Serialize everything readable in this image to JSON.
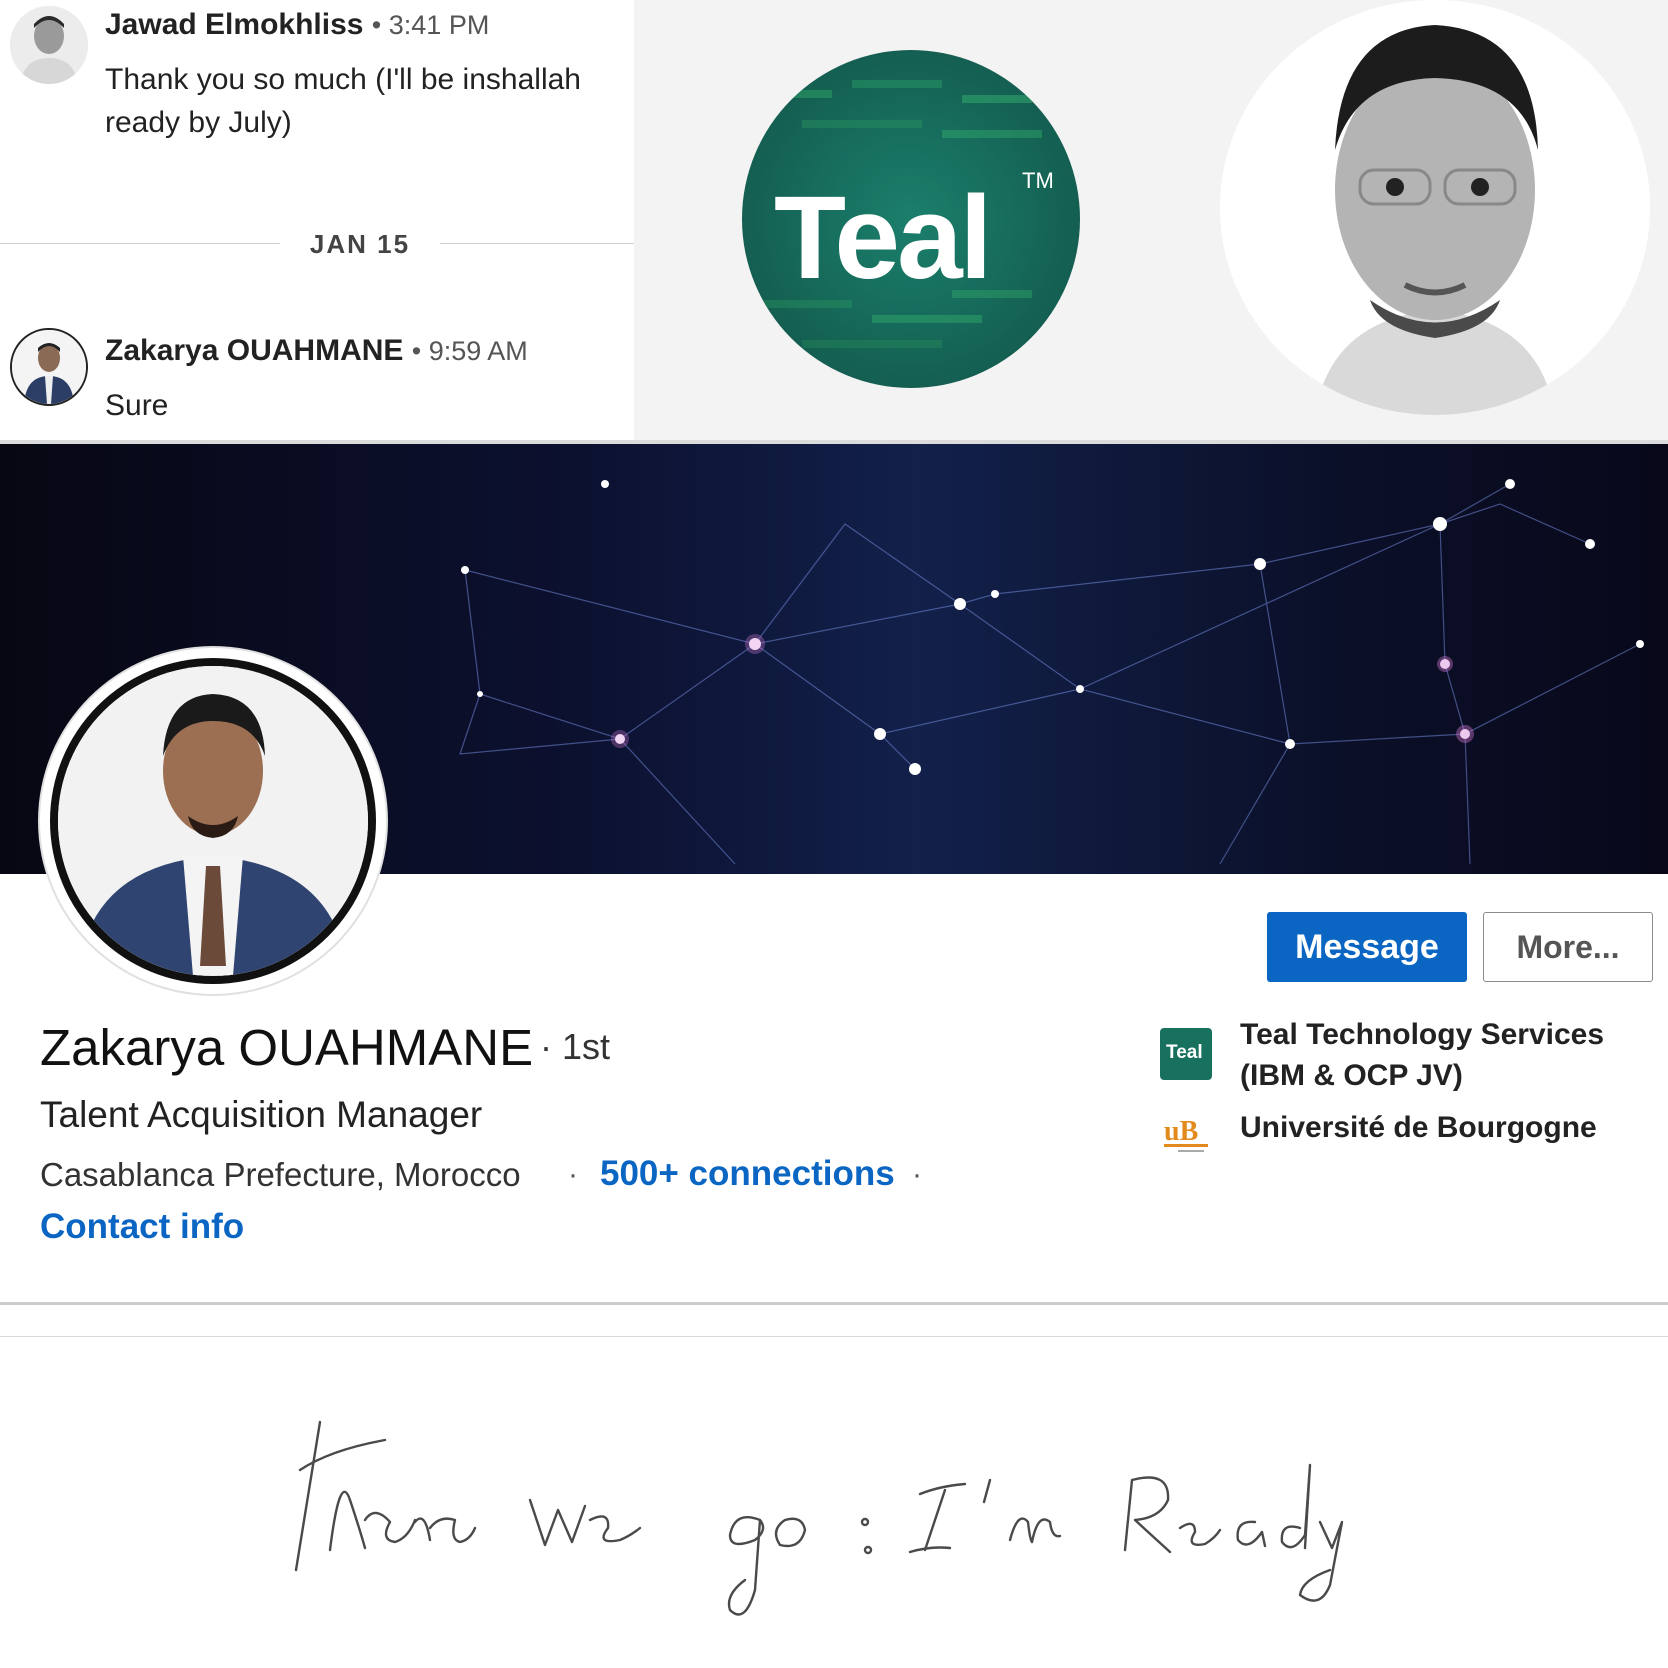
{
  "messages": [
    {
      "sender": "Jawad Elmokhliss",
      "time": "3:41 PM",
      "text_line1": "Thank you so much (I'll be inshallah",
      "text_line2": "ready by July)"
    },
    {
      "sender": "Zakarya OUAHMANE",
      "time": "9:59 AM",
      "text_line1": "Sure"
    }
  ],
  "date_separator": "JAN 15",
  "bullet": "•",
  "teal_logo": {
    "wordmark": "Teal",
    "trademark": "TM"
  },
  "profile": {
    "name": "Zakarya OUAHMANE",
    "degree": "· 1st",
    "headline": "Talent Acquisition Manager",
    "location": "Casablanca Prefecture, Morocco",
    "connections": "500+ connections",
    "separator": "·",
    "contact_info": "Contact info",
    "company": "Teal Technology Services (IBM & OCP JV)",
    "company_logo_text": "Teal",
    "school": "Université de Bourgogne",
    "school_logo_text": "uB"
  },
  "actions": {
    "message": "Message",
    "more": "More..."
  },
  "handwritten_note": "There we go : I'm Ready",
  "colors": {
    "accent": "#0a66c2",
    "teal": "#18705f"
  }
}
